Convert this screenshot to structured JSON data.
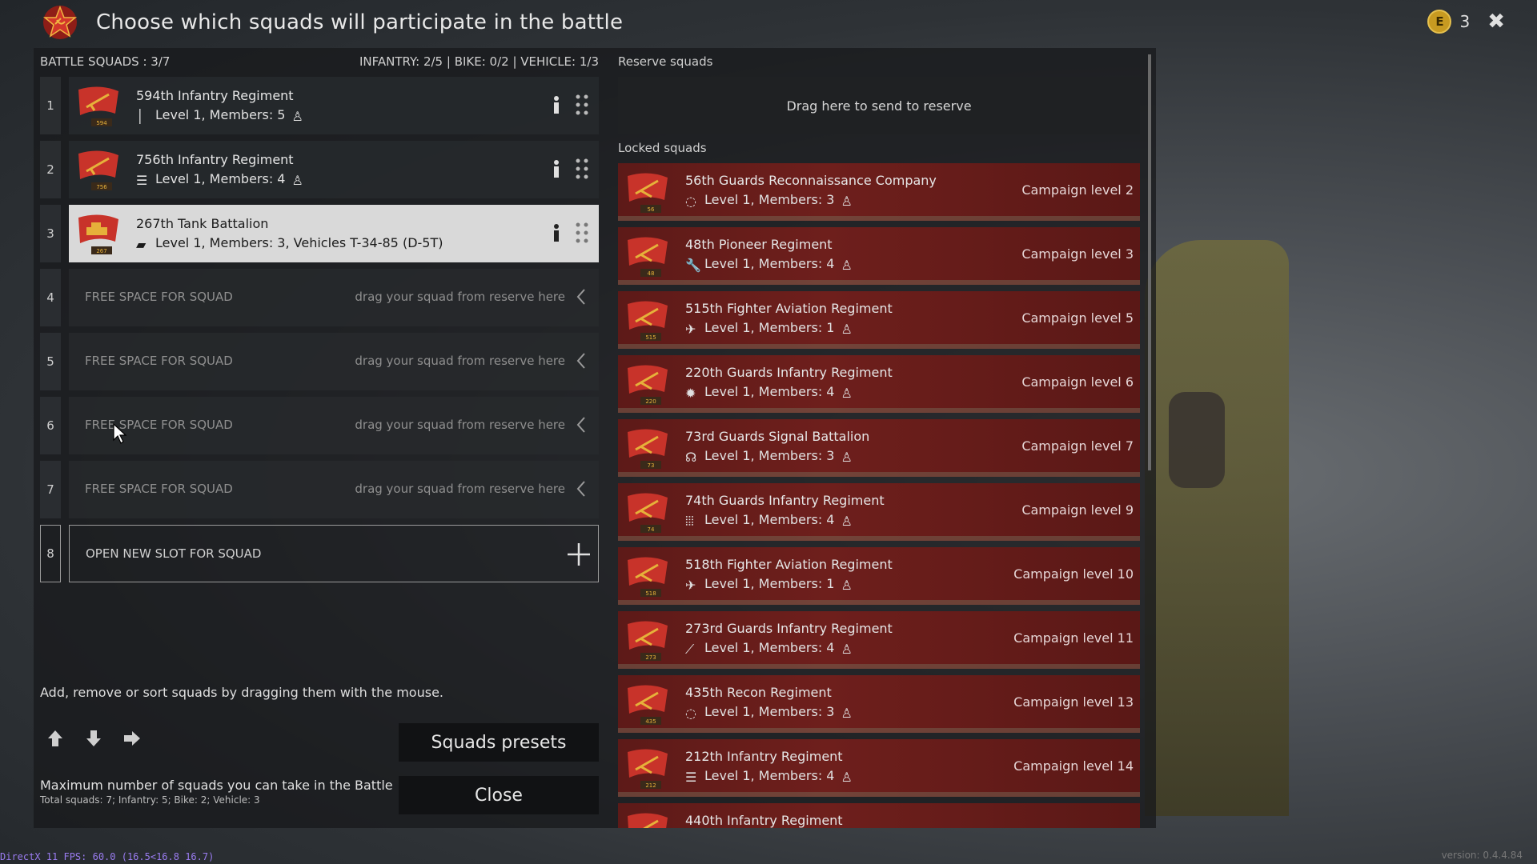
{
  "header": {
    "title": "Choose which squads will participate in the battle",
    "currency_letter": "E",
    "currency_value": "3"
  },
  "left": {
    "battle_squads": "BATTLE SQUADS : 3/7",
    "limits": "INFANTRY: 2/5 | BIKE: 0/2 | VEHICLE: 1/3",
    "slots": [
      {
        "num": "1",
        "name": "594th Infantry Regiment",
        "info": "Level 1, Members: 5",
        "flag_num": "594"
      },
      {
        "num": "2",
        "name": "756th Infantry Regiment",
        "info": "Level 1, Members: 4",
        "flag_num": "756"
      },
      {
        "num": "3",
        "name": "267th Tank Battalion",
        "info": "Level 1, Members: 3, Vehicles T-34-85 (D-5T)",
        "flag_num": "267"
      },
      {
        "num": "4",
        "free": "FREE SPACE FOR SQUAD",
        "hint": "drag your squad from reserve here"
      },
      {
        "num": "5",
        "free": "FREE SPACE FOR SQUAD",
        "hint": "drag your squad from reserve here"
      },
      {
        "num": "6",
        "free": "FREE SPACE FOR SQUAD",
        "hint": "drag your squad from reserve here"
      },
      {
        "num": "7",
        "free": "FREE SPACE FOR SQUAD",
        "hint": "drag your squad from reserve here"
      },
      {
        "num": "8",
        "free": "OPEN NEW SLOT FOR SQUAD"
      }
    ],
    "hint": "Add, remove or sort squads by dragging them with the mouse.",
    "max_title": "Maximum number of squads you can take in the Battle",
    "max_detail": "Total squads: 7; Infantry: 5; Bike: 2; Vehicle: 3",
    "presets_button": "Squads presets",
    "close_button": "Close"
  },
  "right": {
    "reserve_title": "Reserve squads",
    "reserve_drop": "Drag here to send to reserve",
    "locked_title": "Locked squads",
    "locked": [
      {
        "name": "56th Guards Reconnaissance Company",
        "info": "Level 1, Members: 3",
        "campaign": "Campaign level 2",
        "flag_num": "56"
      },
      {
        "name": "48th Pioneer Regiment",
        "info": "Level 1, Members: 4",
        "campaign": "Campaign level 3",
        "flag_num": "48"
      },
      {
        "name": "515th Fighter Aviation Regiment",
        "info": "Level 1, Members: 1",
        "campaign": "Campaign level 5",
        "flag_num": "515"
      },
      {
        "name": "220th Guards Infantry Regiment",
        "info": "Level 1, Members: 4",
        "campaign": "Campaign level 6",
        "flag_num": "220"
      },
      {
        "name": "73rd Guards Signal Battalion",
        "info": "Level 1, Members: 3",
        "campaign": "Campaign level 7",
        "flag_num": "73"
      },
      {
        "name": "74th Guards Infantry Regiment",
        "info": "Level 1, Members: 4",
        "campaign": "Campaign level 9",
        "flag_num": "74"
      },
      {
        "name": "518th Fighter Aviation Regiment",
        "info": "Level 1, Members: 1",
        "campaign": "Campaign level 10",
        "flag_num": "518"
      },
      {
        "name": "273rd Guards Infantry Regiment",
        "info": "Level 1, Members: 4",
        "campaign": "Campaign level 11",
        "flag_num": "273"
      },
      {
        "name": "435th Recon Regiment",
        "info": "Level 1, Members: 3",
        "campaign": "Campaign level 13",
        "flag_num": "435"
      },
      {
        "name": "212th Infantry Regiment",
        "info": "Level 1, Members: 4",
        "campaign": "Campaign level 14",
        "flag_num": "212"
      },
      {
        "name": "440th Infantry Regiment",
        "info": "",
        "campaign": "",
        "flag_num": ""
      }
    ]
  },
  "footer": {
    "fps": "DirectX 11 FPS: 60.0 (16.5<16.8 16.7)",
    "version": "version: 0.4.4.84"
  },
  "colors": {
    "locked_bg": "#6e1f1c",
    "flag_red": "#c8332a",
    "flag_gold": "#e6b13a"
  }
}
